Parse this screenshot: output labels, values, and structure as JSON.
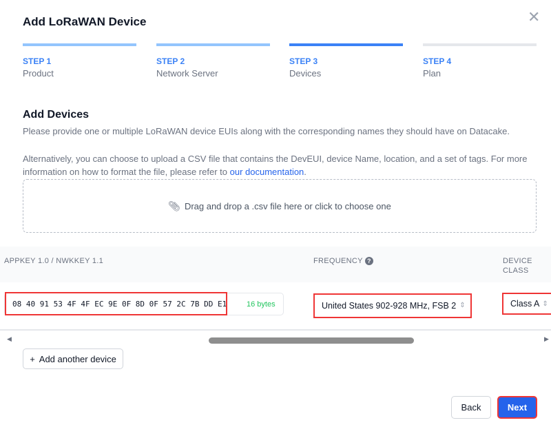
{
  "dialog": {
    "title": "Add LoRaWAN Device",
    "close_icon": "close-icon"
  },
  "steps": [
    {
      "num": "STEP 1",
      "name": "Product",
      "state": "complete"
    },
    {
      "num": "STEP 2",
      "name": "Network Server",
      "state": "complete"
    },
    {
      "num": "STEP 3",
      "name": "Devices",
      "state": "active"
    },
    {
      "num": "STEP 4",
      "name": "Plan",
      "state": "pending"
    }
  ],
  "section": {
    "title": "Add Devices",
    "desc1": "Please provide one or multiple LoRaWAN device EUIs along with the corresponding names they should have on Datacake.",
    "desc2": "Alternatively, you can choose to upload a CSV file that contains the DevEUI, device Name, location, and a set of tags. For more information on how to format the file, please refer to ",
    "doc_link": "our documentation",
    "desc2_end": "."
  },
  "dropzone": {
    "label": "Drag and drop a .csv file here or click to choose one",
    "icon": "paperclip-icon"
  },
  "table": {
    "columns": [
      "APPKEY 1.0 / NWKKEY 1.1",
      "FREQUENCY",
      "DEVICE CLASS"
    ],
    "row": {
      "appkey": "08 40 91 53 4F 4F EC 9E 0F 8D 0F 57 2C 7B DD E1",
      "appkey_bytes": "16 bytes",
      "frequency": "United States 902-928 MHz, FSB 2",
      "device_class": "Class A"
    }
  },
  "buttons": {
    "add_device": "Add another device",
    "back": "Back",
    "next": "Next"
  },
  "colors": {
    "accent": "#2563eb",
    "highlight": "#ef3535",
    "success": "#22c55e"
  }
}
